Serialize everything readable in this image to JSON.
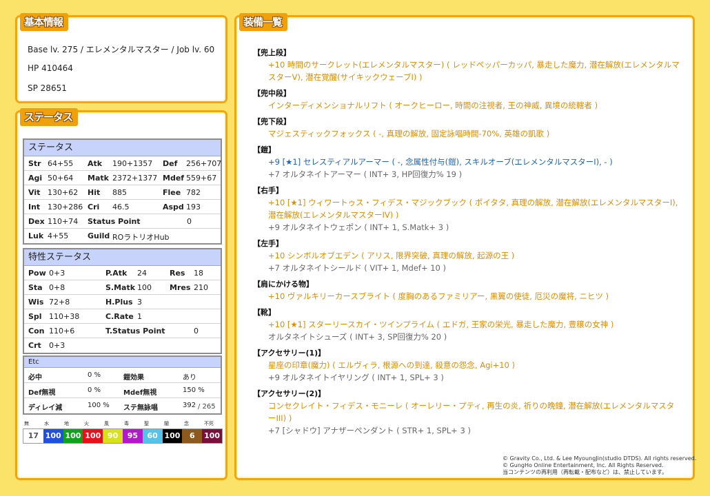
{
  "basic": {
    "title": "基本情報",
    "base_line": "Base lv. 275 / エレメンタルマスター / Job lv. 60",
    "hp_line": "HP 410464",
    "sp_line": "SP 28651"
  },
  "status": {
    "title": "ステータス",
    "main": {
      "header": "ステータス",
      "rows": [
        [
          {
            "l": "Str",
            "v": "64+55"
          },
          {
            "l": "Atk",
            "v": "190+1357"
          },
          {
            "l": "Def",
            "v": "256+707"
          }
        ],
        [
          {
            "l": "Agi",
            "v": "50+64"
          },
          {
            "l": "Matk",
            "v": "2372+1377"
          },
          {
            "l": "Mdef",
            "v": "559+67"
          }
        ],
        [
          {
            "l": "Vit",
            "v": "130+62"
          },
          {
            "l": "Hit",
            "v": "885"
          },
          {
            "l": "Flee",
            "v": "782"
          }
        ],
        [
          {
            "l": "Int",
            "v": "130+286"
          },
          {
            "l": "Cri",
            "v": "46.5"
          },
          {
            "l": "Aspd",
            "v": "193"
          }
        ],
        [
          {
            "l": "Dex",
            "v": "110+74"
          },
          {
            "l": "Status Point",
            "v": "0"
          }
        ],
        [
          {
            "l": "Luk",
            "v": "4+55"
          },
          {
            "l": "Guild",
            "v": "ROラトリオHub"
          }
        ]
      ]
    },
    "trait": {
      "header": "特性ステータス",
      "rows": [
        [
          {
            "l": "Pow",
            "v": "0+3"
          },
          {
            "l": "P.Atk",
            "v": "24"
          },
          {
            "l": "Res",
            "v": "18"
          }
        ],
        [
          {
            "l": "Sta",
            "v": "0+8"
          },
          {
            "l": "S.Matk",
            "v": "100"
          },
          {
            "l": "Mres",
            "v": "210"
          }
        ],
        [
          {
            "l": "Wis",
            "v": "72+8"
          },
          {
            "l": "H.Plus",
            "v": "3"
          }
        ],
        [
          {
            "l": "Spl",
            "v": "110+38"
          },
          {
            "l": "C.Rate",
            "v": "1"
          }
        ],
        [
          {
            "l": "Con",
            "v": "110+6"
          },
          {
            "l": "T.Status Point",
            "v": "0"
          }
        ],
        [
          {
            "l": "Crt",
            "v": "0+3"
          }
        ]
      ]
    },
    "etc": {
      "header": "Etc",
      "rows": [
        [
          {
            "l": "必中",
            "v": "0 %"
          },
          {
            "l": "鎧効果",
            "v": "あり"
          }
        ],
        [
          {
            "l": "Def無視",
            "v": "0 %"
          },
          {
            "l": "Mdef無視",
            "v": "150 %"
          }
        ],
        [
          {
            "l": "ディレイ減",
            "v": "100 %"
          },
          {
            "l": "ステ無詠唱",
            "v": "392",
            "sub": "/ 265"
          }
        ]
      ]
    },
    "elements": [
      {
        "name": "無",
        "value": "17",
        "bg": "#ffffff",
        "fg": "#555555"
      },
      {
        "name": "水",
        "value": "100",
        "bg": "#1f50e0",
        "fg": "#ffffff"
      },
      {
        "name": "地",
        "value": "100",
        "bg": "#0fa21c",
        "fg": "#ffffff"
      },
      {
        "name": "火",
        "value": "100",
        "bg": "#e8111b",
        "fg": "#ffffff"
      },
      {
        "name": "風",
        "value": "90",
        "bg": "#d7e21b",
        "fg": "#ffffff"
      },
      {
        "name": "毒",
        "value": "95",
        "bg": "#b219c8",
        "fg": "#ffffff"
      },
      {
        "name": "聖",
        "value": "60",
        "bg": "#55c2ea",
        "fg": "#ffffff"
      },
      {
        "name": "闇",
        "value": "100",
        "bg": "#000000",
        "fg": "#ffffff"
      },
      {
        "name": "念",
        "value": "6",
        "bg": "#8c5a1e",
        "fg": "#ffffff"
      },
      {
        "name": "不死",
        "value": "100",
        "bg": "#7a0f3c",
        "fg": "#ffffff"
      }
    ]
  },
  "equip": {
    "title": "装備一覧",
    "slots": [
      {
        "name": "【兜上段】",
        "items": [
          {
            "text": "+10 時間のサークレット(エレメンタルマスター) ( レッドペッパーカッパ, 暴走した魔力, 潜在解放(エレメンタルマスターV), 潜在覚醒(サイキックウェーブI) )",
            "color": "orange"
          }
        ]
      },
      {
        "name": "【兜中段】",
        "items": [
          {
            "text": "インターディメンショナルリフト ( オークヒーロー, 時間の注視者, 王の神威, 異境の統轄者 )",
            "color": "orange"
          }
        ]
      },
      {
        "name": "【兜下段】",
        "items": [
          {
            "text": "マジェスティックフォックス ( -, 真理の解放, 固定詠唱時間-70%, 英雄の凱歌 )",
            "color": "orange"
          }
        ]
      },
      {
        "name": "【鎧】",
        "items": [
          {
            "text": "+9 [★1] セレスティアルアーマー ( -, 念属性付与(鎧), スキルオーブ(エレメンタルマスターI), - )",
            "color": "blue"
          },
          {
            "text": "+7 オルタネイトアーマー ( INT+ 3, HP回復力% 19 )",
            "color": "gray"
          }
        ]
      },
      {
        "name": "【右手】",
        "items": [
          {
            "text": "+10 [★1] ウィワートゥス・フィデス・マジックブック ( ポイタタ, 真理の解放, 潜在解放(エレメンタルマスターI), 潜在解放(エレメンタルマスターIV) )",
            "color": "orange"
          },
          {
            "text": "+9 オルタネイトウェポン ( INT+ 1, S.Matk+ 3 )",
            "color": "gray"
          }
        ]
      },
      {
        "name": "【左手】",
        "items": [
          {
            "text": "+10 シンボルオブエデン ( アリス, 限界突破, 真理の解放, 起源の王 )",
            "color": "orange"
          },
          {
            "text": "+7 オルタネイトシールド ( VIT+ 1, Mdef+ 10 )",
            "color": "gray"
          }
        ]
      },
      {
        "name": "【肩にかける物】",
        "items": [
          {
            "text": "+10 ヴァルキリーカースブライト ( 度胸のあるファミリアー, 黒翼の使徒, 厄災の魔将, ニヒツ )",
            "color": "orange"
          }
        ]
      },
      {
        "name": "【靴】",
        "items": [
          {
            "text": "+10 [★1] スターリースカイ・ツインプライム ( エドガ, 王家の栄光, 暴走した魔力, 豊穣の女神 )",
            "color": "orange"
          },
          {
            "text": "オルタネイトシューズ ( INT+ 3, SP回復力% 20 )",
            "color": "gray"
          }
        ]
      },
      {
        "name": "【アクセサリー(1)】",
        "items": [
          {
            "text": "星座の印章(魔力) ( エルヴィラ, 根源への到達, 殺意の怨念, Agi+10 )",
            "color": "orange"
          },
          {
            "text": "+9 オルタネイトイヤリング ( INT+ 1, SPL+ 3 )",
            "color": "gray"
          }
        ]
      },
      {
        "name": "【アクセサリー(2)】",
        "items": [
          {
            "text": "コンセクレイト・フィデス・モニーレ ( オーレリー・プティ, 再生の炎, 祈りの晩鐘, 潜在解放(エレメンタルマスターIII) )",
            "color": "orange"
          },
          {
            "text": "+7 [シャドウ] アナザーペンダント ( STR+ 1, SPL+ 3 )",
            "color": "gray"
          }
        ]
      }
    ]
  },
  "copyright": [
    "© Gravity Co., Ltd. & Lee MyoungJin(studio DTDS). All rights reserved.",
    "© GungHo Online Entertainment, Inc. All Rights Reserved.",
    "当コンテンツの再利用（再転載・配布など）は、禁止しています。"
  ]
}
